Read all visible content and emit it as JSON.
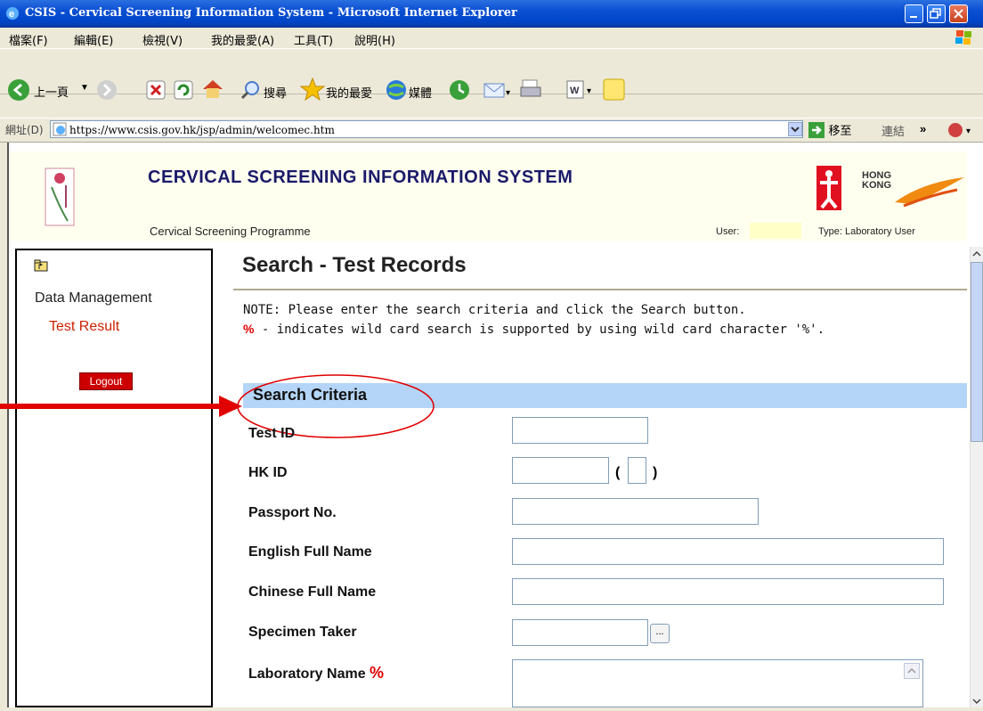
{
  "window": {
    "title": "CSIS - Cervical Screening Information System - Microsoft Internet Explorer"
  },
  "menu": [
    "檔案(F)",
    "編輯(E)",
    "檢視(V)",
    "我的最愛(A)",
    "工具(T)",
    "說明(H)"
  ],
  "toolbar": {
    "back_label": "上一頁",
    "search_label": "搜尋",
    "favorites_label": "我的最愛",
    "media_label": "媒體"
  },
  "addressbar": {
    "label": "網址(D)",
    "url": "https://www.csis.gov.hk/jsp/admin/welcomec.htm",
    "go_label": "移至",
    "links_label": "連結"
  },
  "header": {
    "title": "CERVICAL SCREENING INFORMATION SYSTEM",
    "subtitle": "Cervical Screening Programme",
    "user_label": "User:",
    "user_value": "",
    "type_label": "Type: Laboratory User",
    "hk_logo_text": "HONG KONG"
  },
  "nav": {
    "section": "Data Management",
    "item": "Test Result",
    "logout": "Logout"
  },
  "main": {
    "title": "Search - Test Records",
    "note_line1": "NOTE: Please enter the search criteria and click the Search button.",
    "note_pct": "%",
    "note_line2": " - indicates wild card search is supported by using wild card character '%'.",
    "criteria_title": "Search Criteria",
    "fields": {
      "test_id": "Test ID",
      "hk_id": "HK ID",
      "passport": "Passport No.",
      "english_name": "English Full Name",
      "chinese_name": "Chinese Full Name",
      "specimen_taker": "Specimen Taker",
      "lab_name": "Laboratory Name",
      "lab_pct": "%"
    },
    "hkid_open": "(",
    "hkid_close": ")",
    "lookup_btn": "..."
  },
  "colors": {
    "annotation_red": "#e00000",
    "criteria_band": "#b4d5f7",
    "title_bar": "#0a4fd2"
  }
}
